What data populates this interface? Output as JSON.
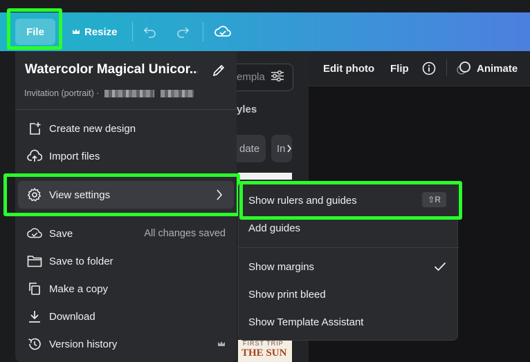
{
  "topbar": {
    "file_label": "File",
    "resize_label": "Resize"
  },
  "editor": {
    "edit_photo": "Edit photo",
    "flip": "Flip",
    "animate": "Animate"
  },
  "side_panel": {
    "search_placeholder": "empla",
    "styles_label": "yles",
    "chip_date": "date",
    "chip_in": "In",
    "thumb_small": "FIRST TRIP",
    "thumb_big": "THE SUN"
  },
  "file_menu": {
    "title": "Watercolor Magical Unicor...",
    "subtitle": "Invitation (portrait) ·",
    "items": [
      {
        "label": "Create new design",
        "icon": "create-design-icon"
      },
      {
        "label": "Import files",
        "icon": "upload-cloud-icon"
      },
      {
        "label": "View settings",
        "icon": "gear-icon"
      },
      {
        "label": "Save",
        "icon": "cloud-check-icon",
        "status": "All changes saved"
      },
      {
        "label": "Save to folder",
        "icon": "folder-icon"
      },
      {
        "label": "Make a copy",
        "icon": "copy-icon"
      },
      {
        "label": "Download",
        "icon": "download-icon"
      },
      {
        "label": "Version history",
        "icon": "history-icon"
      }
    ]
  },
  "view_submenu": {
    "items": [
      {
        "label": "Show rulers and guides",
        "shortcut": "⇧R"
      },
      {
        "label": "Add guides"
      },
      {
        "label": "Show margins",
        "checked": true
      },
      {
        "label": "Show print bleed"
      },
      {
        "label": "Show Template Assistant"
      }
    ]
  },
  "colors": {
    "highlight": "#2aff2a",
    "topbar_start": "#1fb3c8",
    "topbar_end": "#4d7fe0",
    "menu_bg": "#2a2b2f"
  }
}
